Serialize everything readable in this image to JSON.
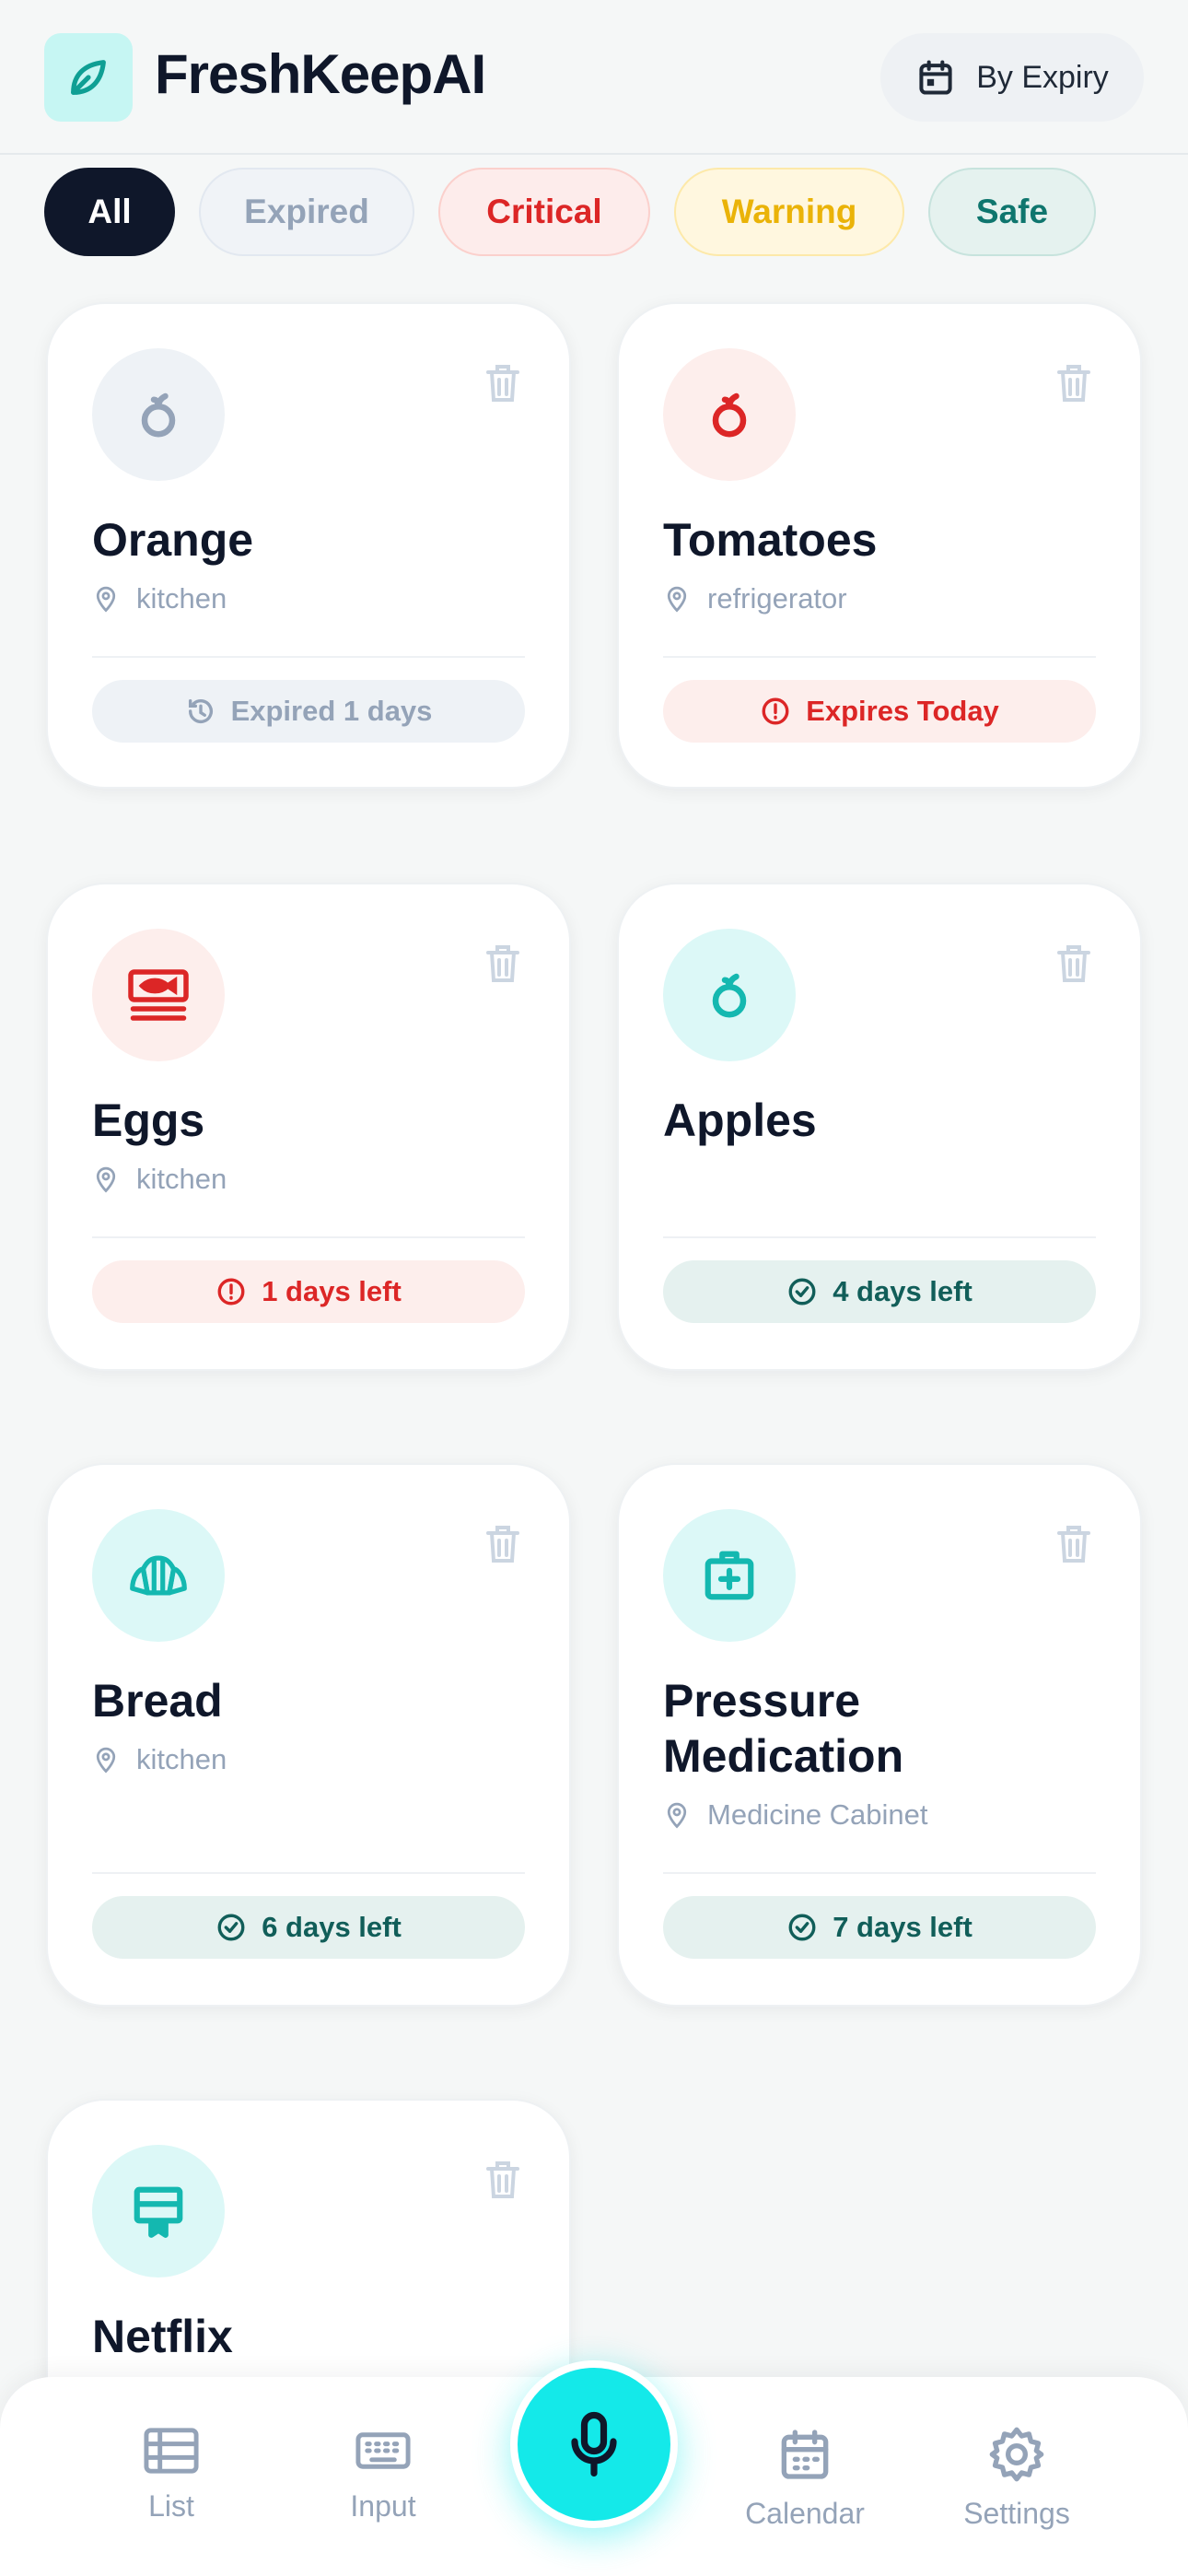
{
  "header": {
    "app_title": "FreshKeepAI",
    "sort_label": "By Expiry"
  },
  "filters": [
    {
      "label": "All",
      "active": true
    },
    {
      "label": "Expired"
    },
    {
      "label": "Critical"
    },
    {
      "label": "Warning"
    },
    {
      "label": "Safe"
    }
  ],
  "items": [
    {
      "name": "Orange",
      "location": "kitchen",
      "status": "Expired 1 days",
      "status_type": "expired",
      "icon": "fruit-icon"
    },
    {
      "name": "Tomatoes",
      "location": "refrigerator",
      "status": "Expires Today",
      "status_type": "critical",
      "icon": "fruit-icon"
    },
    {
      "name": "Eggs",
      "location": "kitchen",
      "status": "1 days left",
      "status_type": "critical",
      "icon": "fish-icon"
    },
    {
      "name": "Apples",
      "location": "",
      "status": "4 days left",
      "status_type": "safe",
      "icon": "fruit-icon"
    },
    {
      "name": "Bread",
      "location": "kitchen",
      "status": "6 days left",
      "status_type": "safe",
      "icon": "croissant-icon"
    },
    {
      "name": "Pressure Medication",
      "location": "Medicine Cabinet",
      "status": "7 days left",
      "status_type": "safe",
      "icon": "medical-kit-icon"
    },
    {
      "name": "Netflix",
      "location": "",
      "status": "",
      "status_type": "",
      "icon": "subscription-icon"
    }
  ],
  "nav": {
    "list": "List",
    "input": "Input",
    "calendar": "Calendar",
    "settings": "Settings"
  },
  "colors": {
    "accent": "#14e9e9",
    "critical": "#dc2626",
    "safe": "#115e59",
    "warning": "#eab308",
    "expired": "#94a3b8"
  }
}
